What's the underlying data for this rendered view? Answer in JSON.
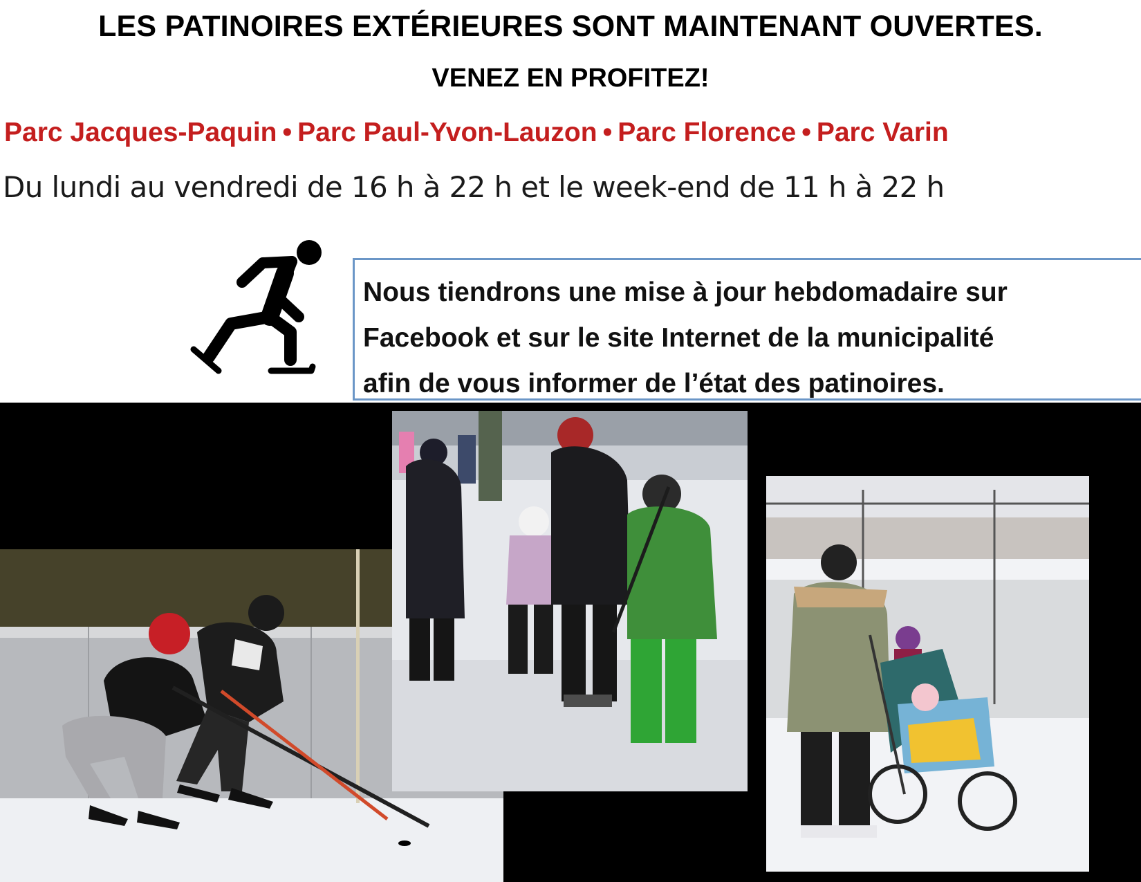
{
  "header": {
    "title": "LES PATINOIRES EXTÉRIEURES SONT MAINTENANT OUVERTES.",
    "subtitle": "VENEZ EN PROFITEZ!"
  },
  "parks": [
    "Parc Jacques-Paquin",
    "Parc Paul-Yvon-Lauzon",
    "Parc Florence",
    "Parc Varin"
  ],
  "separator": "•",
  "hours": "Du lundi au vendredi de 16 h à 22 h et le week-end de 11 h à 22 h",
  "info": {
    "lines": [
      "Nous tiendrons une mise à jour hebdomadaire sur",
      "Facebook et sur le site Internet de la municipalité",
      "afin de vous informer de l’état des patinoires."
    ]
  },
  "icons": {
    "skater": "ice-skater-icon"
  },
  "colors": {
    "parks": "#c41e1e",
    "info_border": "#6b96c7",
    "band": "#000000"
  }
}
